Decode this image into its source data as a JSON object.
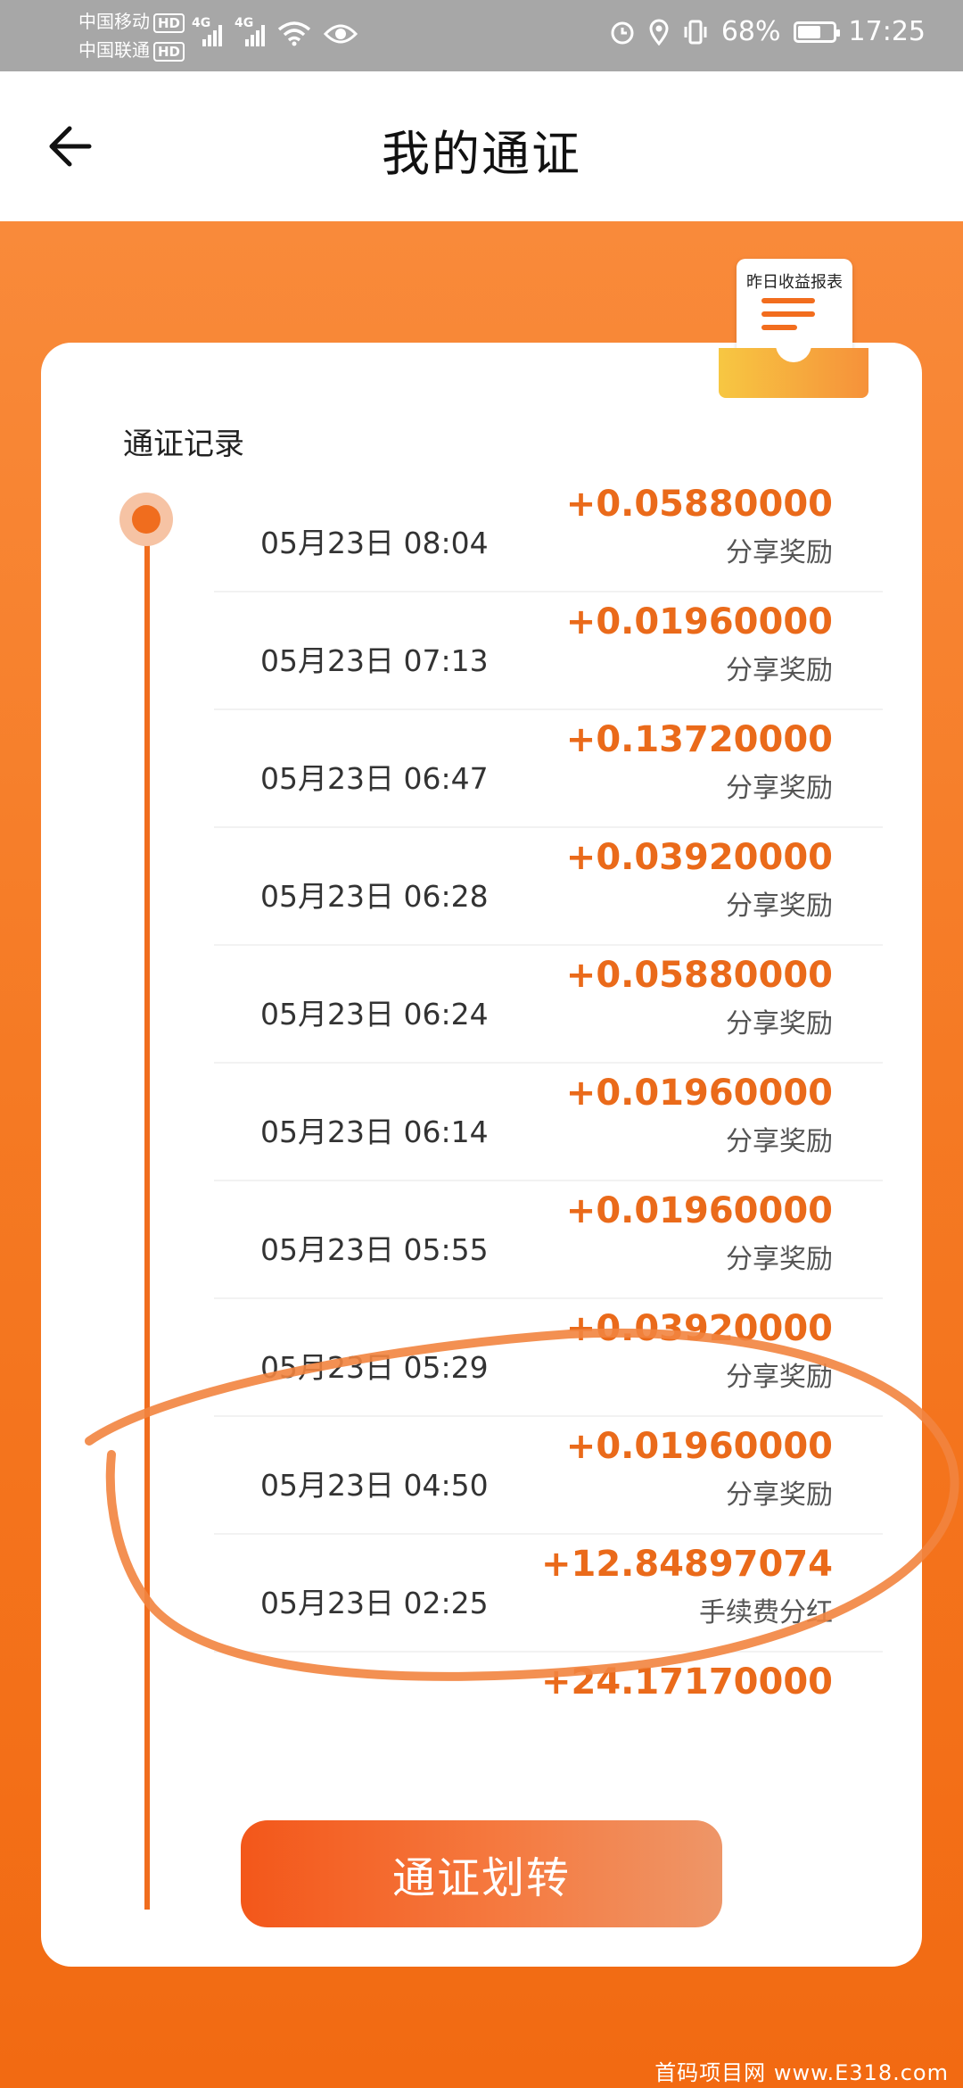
{
  "status_bar": {
    "carrier1": "中国移动",
    "carrier2": "中国联通",
    "hd": "HD",
    "net1": "4G",
    "net2": "4G",
    "battery_text": "68%",
    "battery_level": 0.68,
    "time": "17:25",
    "icons": [
      "alarm-icon",
      "location-icon",
      "vibrate-icon",
      "wifi-icon",
      "eye-icon"
    ]
  },
  "header": {
    "title": "我的通证",
    "back_icon": "arrow-left-icon"
  },
  "report_badge": {
    "label": "昨日收益报表"
  },
  "card": {
    "section_title": "通证记录",
    "records": [
      {
        "time": "05月23日 08:04",
        "amount": "+0.05880000",
        "type": "分享奖励"
      },
      {
        "time": "05月23日 07:13",
        "amount": "+0.01960000",
        "type": "分享奖励"
      },
      {
        "time": "05月23日 06:47",
        "amount": "+0.13720000",
        "type": "分享奖励"
      },
      {
        "time": "05月23日 06:28",
        "amount": "+0.03920000",
        "type": "分享奖励"
      },
      {
        "time": "05月23日 06:24",
        "amount": "+0.05880000",
        "type": "分享奖励"
      },
      {
        "time": "05月23日 06:14",
        "amount": "+0.01960000",
        "type": "分享奖励"
      },
      {
        "time": "05月23日 05:55",
        "amount": "+0.01960000",
        "type": "分享奖励"
      },
      {
        "time": "05月23日 05:29",
        "amount": "+0.03920000",
        "type": "分享奖励"
      },
      {
        "time": "05月23日 04:50",
        "amount": "+0.01960000",
        "type": "分享奖励"
      },
      {
        "time": "05月23日 02:25",
        "amount": "+12.84897074",
        "type": "手续费分红"
      },
      {
        "time": "",
        "amount": "+24.17170000",
        "type": ""
      }
    ],
    "transfer_button": "通证划转"
  },
  "colors": {
    "accent": "#f06d1e",
    "amount": "#ea6a1a",
    "annotation": "#f2843f"
  },
  "watermark": "首码项目网 www.E318.com"
}
